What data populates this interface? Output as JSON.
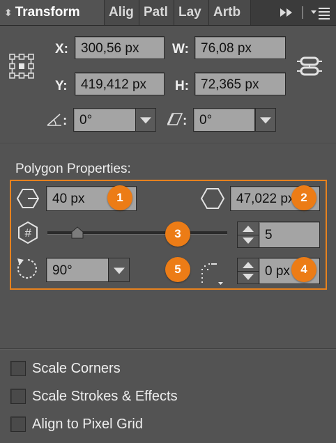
{
  "tabs": [
    {
      "label": "Transform",
      "active": true
    },
    {
      "label": "Alig",
      "active": false
    },
    {
      "label": "Patl",
      "active": false
    },
    {
      "label": "Lay",
      "active": false
    },
    {
      "label": "Artb",
      "active": false
    }
  ],
  "tab_overflow_icon": "double-chevron-right-icon",
  "panel_menu_icon": "panel-menu-icon",
  "transform": {
    "x_label": "X:",
    "x_value": "300,56 px",
    "y_label": "Y:",
    "y_value": "419,412 px",
    "w_label": "W:",
    "w_value": "76,08 px",
    "h_label": "H:",
    "h_value": "72,365 px",
    "angle_label": ":",
    "angle_value": "0°",
    "shear_label": ":",
    "shear_value": "0°"
  },
  "polygon": {
    "section_title": "Polygon Properties:",
    "radius_value": "40 px",
    "side_length_value": "47,022 px",
    "sides_value": "5",
    "sides_slider_fraction": 0.14,
    "rotation_value": "90°",
    "corner_radius_value": "0 px"
  },
  "badges": [
    "1",
    "2",
    "3",
    "4",
    "5"
  ],
  "badge_color": "#ec7c16",
  "highlight_color": "#e8821e",
  "options": [
    {
      "label": "Scale Corners",
      "checked": false
    },
    {
      "label": "Scale Strokes & Effects",
      "checked": false
    },
    {
      "label": "Align to Pixel Grid",
      "checked": false
    }
  ]
}
